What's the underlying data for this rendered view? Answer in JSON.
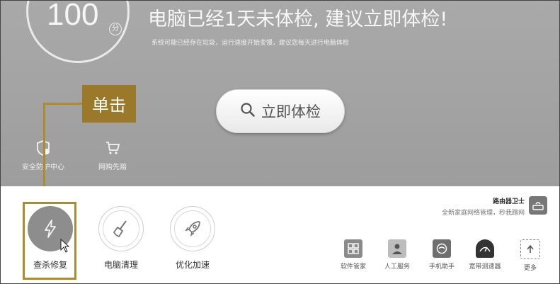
{
  "score": {
    "value": "100",
    "unit": "分"
  },
  "header": {
    "headline": "电脑已经1天未体检, 建议立即体检!",
    "subline": "系统可能已经存在垃圾，运行速度开始变慢，建议您每天进行电脑体检"
  },
  "check_button": {
    "label": "立即体检",
    "icon": "search-icon"
  },
  "small_tools": [
    {
      "label": "安全防护中心",
      "icon": "shield-icon"
    },
    {
      "label": "网购先赔",
      "icon": "shopping-cart-icon"
    }
  ],
  "callout": {
    "label": "单击"
  },
  "main_tools": [
    {
      "label": "查杀修复",
      "icon": "lightning-icon"
    },
    {
      "label": "电脑清理",
      "icon": "broom-icon"
    },
    {
      "label": "优化加速",
      "icon": "rocket-icon"
    }
  ],
  "router": {
    "title": "路由器卫士",
    "desc": "全新家庭网络管理，秒我蹭网"
  },
  "mini_apps": [
    {
      "label": "软件管家",
      "icon": "apps-grid-icon"
    },
    {
      "label": "人工服务",
      "icon": "person-service-icon"
    },
    {
      "label": "手机助手",
      "icon": "phone-assistant-icon"
    },
    {
      "label": "宽带测速器",
      "icon": "speed-meter-icon"
    },
    {
      "label": "更多",
      "icon": "more-arrow-icon"
    }
  ],
  "colors": {
    "annotation": "#b08a2c",
    "top_bg": "#a6a6a6"
  }
}
